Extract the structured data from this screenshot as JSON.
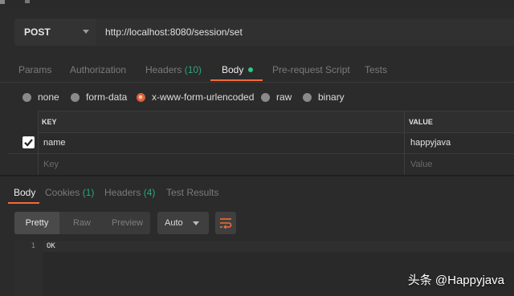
{
  "request": {
    "method": "POST",
    "url": "http://localhost:8080/session/set"
  },
  "request_tabs": [
    {
      "label": "Params",
      "count": "",
      "active": false
    },
    {
      "label": "Authorization",
      "count": "",
      "active": false
    },
    {
      "label": "Headers",
      "count": "(10)",
      "active": false
    },
    {
      "label": "Body",
      "count": "",
      "active": true
    },
    {
      "label": "Pre-request Script",
      "count": "",
      "active": false
    },
    {
      "label": "Tests",
      "count": "",
      "active": false
    }
  ],
  "body_types": [
    {
      "label": "none",
      "selected": false
    },
    {
      "label": "form-data",
      "selected": false
    },
    {
      "label": "x-www-form-urlencoded",
      "selected": true
    },
    {
      "label": "raw",
      "selected": false
    },
    {
      "label": "binary",
      "selected": false
    }
  ],
  "params_table": {
    "headers": {
      "key": "KEY",
      "value": "VALUE"
    },
    "rows": [
      {
        "checked": true,
        "key": "name",
        "value": "happyjava"
      }
    ],
    "placeholder": {
      "key": "Key",
      "value": "Value"
    }
  },
  "response_tabs": [
    {
      "label": "Body",
      "count": "",
      "active": true
    },
    {
      "label": "Cookies",
      "count": "(1)",
      "active": false
    },
    {
      "label": "Headers",
      "count": "(4)",
      "active": false
    },
    {
      "label": "Test Results",
      "count": "",
      "active": false
    }
  ],
  "response_view": {
    "modes": [
      "Pretty",
      "Raw",
      "Preview"
    ],
    "active_mode": "Pretty",
    "format": "Auto",
    "wrap_icon": "wrap-lines-icon"
  },
  "response_body": {
    "lines": [
      {
        "number": "1",
        "text": "OK"
      }
    ]
  },
  "watermark": "头条 @Happyjava",
  "colors": {
    "accent": "#f26b3a",
    "count_green": "#2aa67a",
    "status_dot": "#2cc97f",
    "background": "#2b2b2b"
  }
}
